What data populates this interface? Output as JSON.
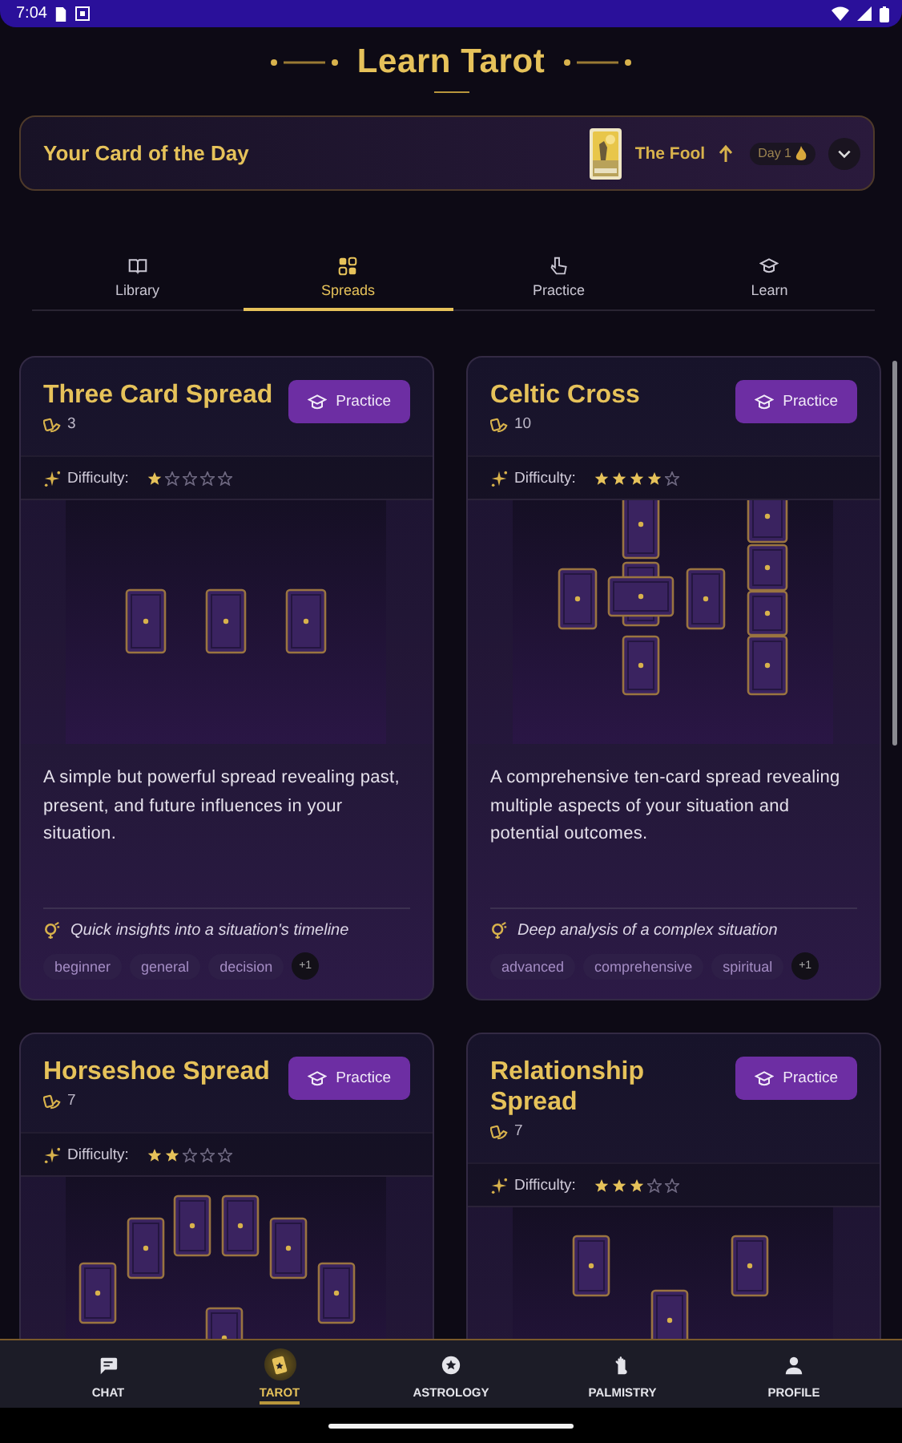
{
  "status_bar": {
    "time": "7:04"
  },
  "header": {
    "title": "Learn Tarot"
  },
  "card_of_the_day": {
    "label": "Your Card of the Day",
    "card_name": "The Fool",
    "upright": true,
    "streak": "Day 1",
    "expanded": false
  },
  "tabs": [
    {
      "label": "Library",
      "kind": "book",
      "selected": false
    },
    {
      "label": "Spreads",
      "kind": "grid",
      "selected": true
    },
    {
      "label": "Practice",
      "kind": "pointer",
      "selected": false
    },
    {
      "label": "Learn",
      "kind": "cap",
      "selected": false
    }
  ],
  "spreads": [
    {
      "title": "Three Card Spread",
      "card_count": "3",
      "action": "Practice",
      "difficulty_label": "Difficulty:",
      "stars": 1,
      "kind": "three",
      "description": "A simple but powerful spread revealing past, present, and future influences in your situation.",
      "purpose": "Quick insights into a situation's timeline",
      "tags": [
        "beginner",
        "general",
        "decision"
      ],
      "more_tags": "+1"
    },
    {
      "title": "Celtic Cross",
      "card_count": "10",
      "action": "Practice",
      "difficulty_label": "Difficulty:",
      "stars": 4,
      "kind": "celtic",
      "description": "A comprehensive ten-card spread revealing multiple aspects of your situation and potential outcomes.",
      "purpose": "Deep analysis of a complex situation",
      "tags": [
        "advanced",
        "comprehensive",
        "spiritual"
      ],
      "more_tags": "+1"
    },
    {
      "title": "Horseshoe Spread",
      "card_count": "7",
      "action": "Practice",
      "difficulty_label": "Difficulty:",
      "stars": 2,
      "kind": "horseshoe"
    },
    {
      "title": "Relationship Spread",
      "card_count": "7",
      "action": "Practice",
      "difficulty_label": "Difficulty:",
      "stars": 3,
      "kind": "relationship"
    }
  ],
  "bottom_nav": [
    {
      "label": "CHAT",
      "kind": "chat",
      "selected": false
    },
    {
      "label": "TAROT",
      "kind": "tarot",
      "selected": true
    },
    {
      "label": "ASTROLOGY",
      "kind": "astro",
      "selected": false
    },
    {
      "label": "PALMISTRY",
      "kind": "palm",
      "selected": false
    },
    {
      "label": "PROFILE",
      "kind": "profile",
      "selected": false
    }
  ]
}
